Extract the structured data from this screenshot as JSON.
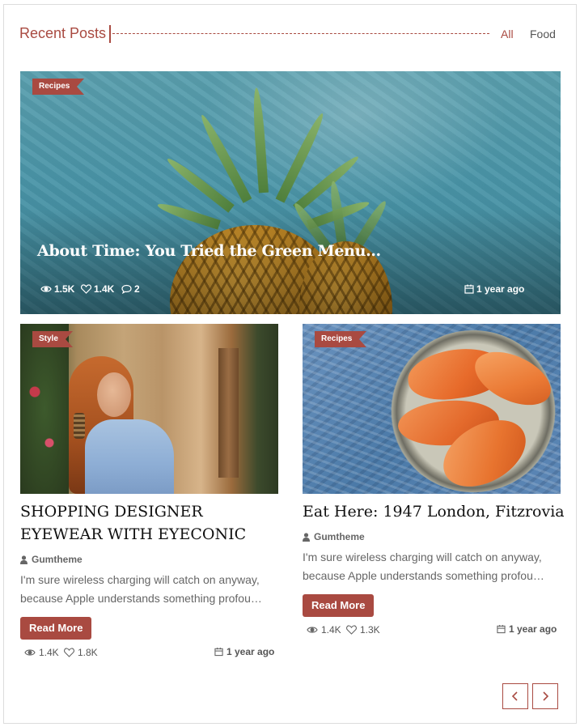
{
  "header": {
    "title": "Recent Posts",
    "tabs": [
      "All",
      "Food"
    ]
  },
  "featured": {
    "category": "Recipes",
    "title": "About Time: You Tried the Green Menu…",
    "views": "1.5K",
    "likes": "1.4K",
    "comments": "2",
    "date": "1 year ago"
  },
  "posts": [
    {
      "category": "Style",
      "title": "SHOPPING DESIGNER EYEWEAR WITH EYECONIC",
      "author": "Gumtheme",
      "excerpt": "I'm sure wireless charging will catch on anyway, because Apple understands something profou…",
      "button": "Read More",
      "views": "1.4K",
      "likes": "1.8K",
      "date": "1 year ago"
    },
    {
      "category": "Recipes",
      "title": "Eat Here: 1947 London, Fitzrovia",
      "author": "Gumtheme",
      "excerpt": "I'm sure wireless charging will catch on anyway, because Apple understands something profou…",
      "button": "Read More",
      "views": "1.4K",
      "likes": "1.3K",
      "date": "1 year ago"
    }
  ],
  "pagination": {
    "prev_icon": "chevron-left-icon",
    "next_icon": "chevron-right-icon"
  },
  "colors": {
    "accent": "#a94a41"
  }
}
